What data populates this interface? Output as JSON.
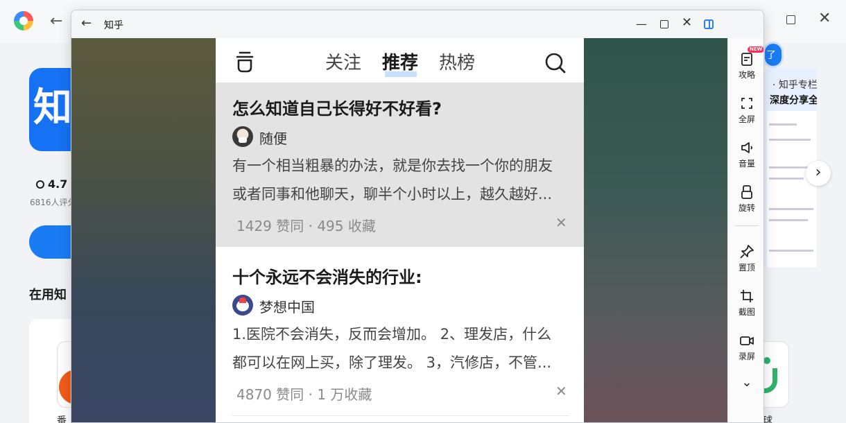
{
  "background": {
    "app_icon_text": "知",
    "rating": "4.7",
    "rating_count": "6816人评分",
    "section_title": "在用知",
    "card_text": "番",
    "right_pill": "了",
    "zhihu_card_line1": "知乎专栏",
    "zhihu_card_line2": "深度分享全",
    "right_card_text": "球"
  },
  "window": {
    "title": "知乎"
  },
  "phone": {
    "tabs": [
      {
        "label": "关注",
        "active": false
      },
      {
        "label": "推荐",
        "active": true
      },
      {
        "label": "热榜",
        "active": false
      }
    ],
    "feed": [
      {
        "title": "怎么知道自己长得好不好看?",
        "author": "随便",
        "excerpt_line1": "有一个相当粗暴的办法，就是你去找一个你的朋友",
        "excerpt_line2": "或者同事和他聊天，聊半个小时以上，越久越好...",
        "stats": "1429 赞同 · 495 收藏"
      },
      {
        "title": "十个永远不会消失的行业:",
        "author": "梦想中国",
        "excerpt_line1": "1.医院不会消失，反而会增加。 2、理发店，什么",
        "excerpt_line2": "都可以在网上买，除了理发。 3，汽修店，不管...",
        "stats": "4870 赞同 · 1 万收藏"
      }
    ]
  },
  "toolbar": {
    "new_badge": "NEW",
    "items": [
      {
        "label": "攻略",
        "icon": "guide-icon"
      },
      {
        "label": "全屏",
        "icon": "fullscreen-icon"
      },
      {
        "label": "音量",
        "icon": "volume-icon"
      },
      {
        "label": "旋转",
        "icon": "rotate-icon"
      },
      {
        "label": "置顶",
        "icon": "pin-icon"
      },
      {
        "label": "截图",
        "icon": "crop-icon"
      },
      {
        "label": "录屏",
        "icon": "record-icon"
      }
    ]
  },
  "colors": {
    "accent": "#2e7cf6",
    "highlight": "#e3e3e3",
    "tab_underline": "#c7e0ff",
    "badge": "#ff2d55"
  }
}
